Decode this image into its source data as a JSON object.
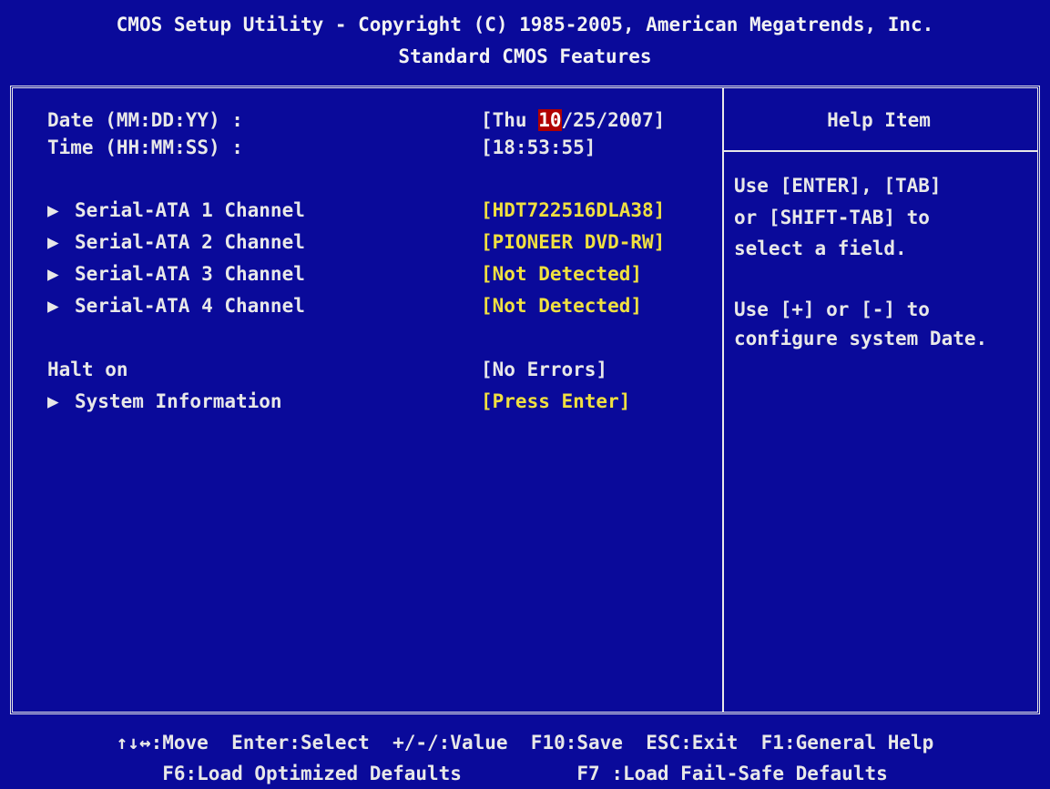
{
  "header": {
    "title": "CMOS Setup Utility - Copyright (C) 1985-2005, American Megatrends, Inc.",
    "subtitle": "Standard CMOS Features"
  },
  "fields": {
    "date_label": "Date (MM:DD:YY) :",
    "date_prefix": "[Thu ",
    "date_selected": "10",
    "date_suffix": "/25/2007]",
    "time_label": "Time (HH:MM:SS) :",
    "time_value": "[18:53:55]",
    "sata1_label": "Serial-ATA 1 Channel",
    "sata1_value": "[HDT722516DLA38]",
    "sata2_label": "Serial-ATA 2 Channel",
    "sata2_value": "[PIONEER DVD-RW]",
    "sata3_label": "Serial-ATA 3 Channel",
    "sata3_value": "[Not Detected]",
    "sata4_label": "Serial-ATA 4 Channel",
    "sata4_value": "[Not Detected]",
    "halt_label": "Halt on",
    "halt_value": "[No Errors]",
    "sysinfo_label": "System Information",
    "sysinfo_value": "[Press Enter]",
    "submenu_arrow": "▶"
  },
  "help": {
    "title": "Help Item",
    "line1": "Use [ENTER], [TAB]",
    "line2": "or [SHIFT-TAB] to",
    "line3": "select a field.",
    "line4": "Use [+] or [-] to",
    "line5": "configure system Date."
  },
  "footer": {
    "line1": "↑↓↔:Move  Enter:Select  +/-/:Value  F10:Save  ESC:Exit  F1:General Help",
    "line2": "F6:Load Optimized Defaults          F7 :Load Fail-Safe Defaults"
  },
  "colors": {
    "background": "#0a0a9a",
    "text": "#e8e8e8",
    "value_highlight": "#f0e040",
    "selection": "#b00000"
  }
}
